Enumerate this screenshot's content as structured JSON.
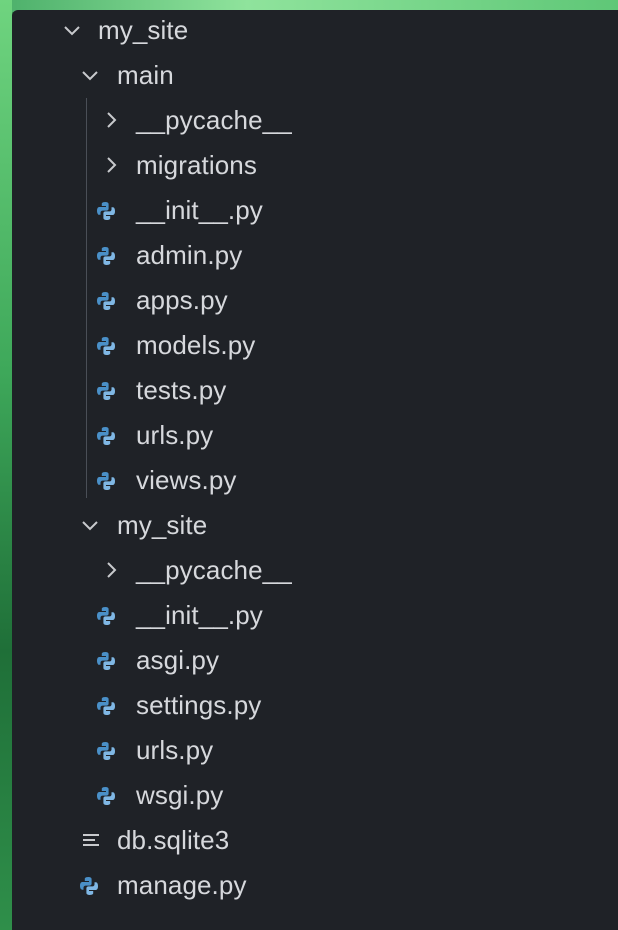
{
  "explorer": {
    "root": {
      "label": "my_site",
      "expanded": true,
      "children": [
        {
          "label": "main",
          "expanded": true,
          "children": [
            {
              "label": "__pycache__",
              "type": "folder",
              "expanded": false
            },
            {
              "label": "migrations",
              "type": "folder",
              "expanded": false
            },
            {
              "label": "__init__.py",
              "type": "python"
            },
            {
              "label": "admin.py",
              "type": "python"
            },
            {
              "label": "apps.py",
              "type": "python"
            },
            {
              "label": "models.py",
              "type": "python"
            },
            {
              "label": "tests.py",
              "type": "python"
            },
            {
              "label": "urls.py",
              "type": "python"
            },
            {
              "label": "views.py",
              "type": "python"
            }
          ]
        },
        {
          "label": "my_site",
          "expanded": true,
          "children": [
            {
              "label": "__pycache__",
              "type": "folder",
              "expanded": false
            },
            {
              "label": "__init__.py",
              "type": "python"
            },
            {
              "label": "asgi.py",
              "type": "python"
            },
            {
              "label": "settings.py",
              "type": "python"
            },
            {
              "label": "urls.py",
              "type": "python"
            },
            {
              "label": "wsgi.py",
              "type": "python"
            }
          ]
        },
        {
          "label": "db.sqlite3",
          "type": "database"
        },
        {
          "label": "manage.py",
          "type": "python"
        }
      ]
    }
  },
  "colors": {
    "panel_bg": "#1f2227",
    "text": "#d6d8dc",
    "python_icon_blue": "#4a90c8",
    "python_icon_light": "#7fb7e4",
    "chevron": "#c8cacd",
    "guide_line": "#4a4f57",
    "background_green": "#3ea85a"
  },
  "icons": {
    "folder_collapsed": "chevron-right-icon",
    "folder_expanded": "chevron-down-icon",
    "python_file": "python-icon",
    "database_file": "lines-file-icon"
  }
}
